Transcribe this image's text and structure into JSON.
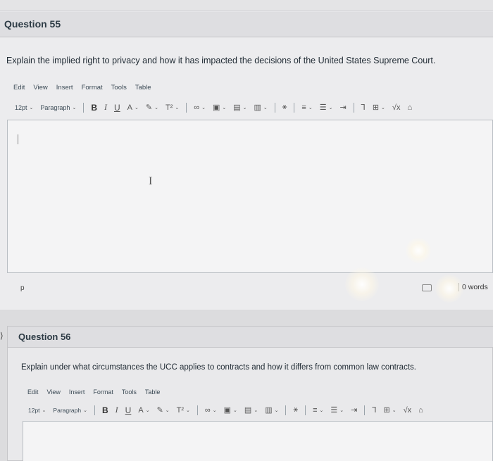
{
  "q1": {
    "title": "Question 55",
    "text": "Explain the implied right to privacy and how it has impacted the decisions of the United States Supreme Court.",
    "menu": [
      "Edit",
      "View",
      "Insert",
      "Format",
      "Tools",
      "Table"
    ],
    "font_size": "12pt",
    "block_format": "Paragraph",
    "status_path": "p",
    "word_count": "0 words"
  },
  "q2": {
    "title": "Question 56",
    "text": "Explain under what circumstances the UCC applies to contracts and how it differs from common law contracts.",
    "menu": [
      "Edit",
      "View",
      "Insert",
      "Format",
      "Tools",
      "Table"
    ],
    "font_size": "12pt",
    "block_format": "Paragraph"
  },
  "toolbar_glyphs": {
    "bold": "B",
    "italic": "I",
    "underline": "U",
    "font_color": "A",
    "highlight": "✎",
    "superscript": "T²",
    "link": "🔗",
    "image": "▣",
    "media": "▤",
    "document": "▥",
    "math": "⚹",
    "align": "≡",
    "list": "☰",
    "indent": "⇥",
    "clear": "Ꞁ",
    "table": "⊞",
    "equation": "√x",
    "more": "⌂"
  },
  "colors": {
    "accent": "#2d3b45",
    "background": "#ececee",
    "editor_bg": "#f4f4f5"
  }
}
